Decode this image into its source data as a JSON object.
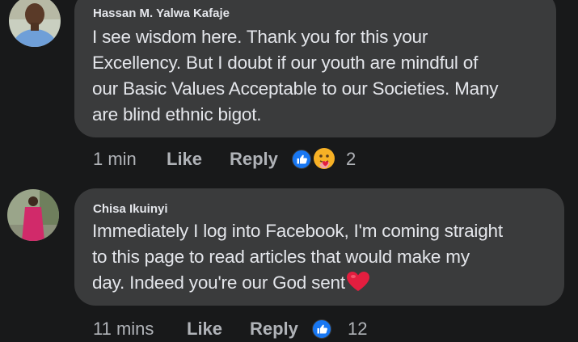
{
  "comments": [
    {
      "author": "Hassan M. Yalwa Kafaje",
      "text_lines": [
        "I see wisdom here. Thank you for this your",
        "Excellency. But I doubt if our youth are mindful of",
        "our Basic Values Acceptable to our Societies. Many",
        "are blind ethnic bigot."
      ],
      "time": "1 min",
      "like_label": "Like",
      "reply_label": "Reply",
      "reactions": [
        "like-icon",
        "care-icon"
      ],
      "reaction_count": "2"
    },
    {
      "author": "Chisa Ikuinyi",
      "text_lines": [
        "Immediately I log into Facebook, I'm coming straight",
        "to this page to read articles that would make my",
        "day. Indeed you're our God sent"
      ],
      "heart_emoji": "heart-icon",
      "time": "11 mins",
      "like_label": "Like",
      "reply_label": "Reply",
      "reactions": [
        "like-icon"
      ],
      "reaction_count": "12"
    }
  ],
  "colors": {
    "background": "#18191a",
    "bubble": "#3a3b3c",
    "text": "#e4e6eb",
    "secondary": "#b0b3b8",
    "like_blue": "#1877f2",
    "heart_red": "#e41e3f"
  }
}
